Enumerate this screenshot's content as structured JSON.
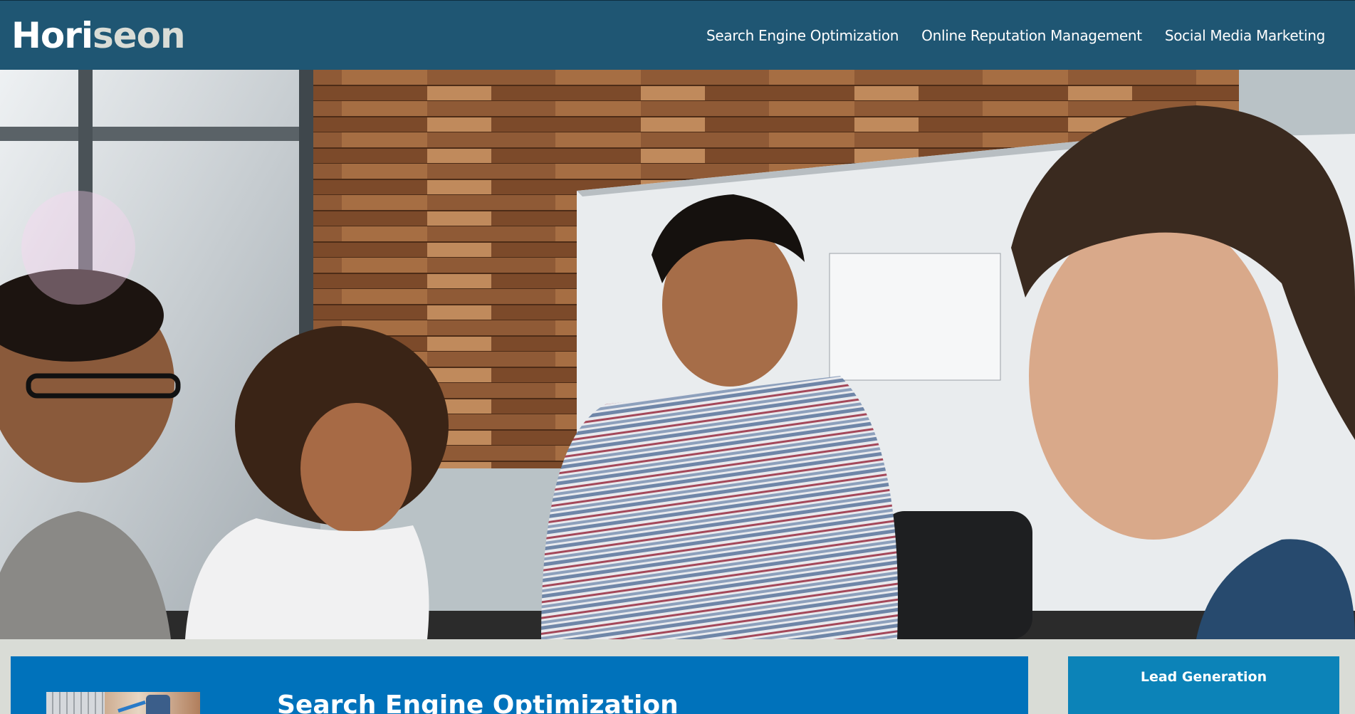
{
  "header": {
    "logo_main": "Hori",
    "logo_accent": "seon",
    "nav": [
      {
        "label": "Search Engine Optimization"
      },
      {
        "label": "Online Reputation Management"
      },
      {
        "label": "Social Media Marketing"
      }
    ]
  },
  "hero": {
    "image": "team-meeting-photo"
  },
  "content": {
    "title": "Search Engine Optimization"
  },
  "aside": {
    "title": "Lead Generation"
  },
  "colors": {
    "header": "#1f5673",
    "page_bg": "#d9dcd6",
    "content_bg": "#0072bb",
    "aside_bg": "#0c83b8"
  }
}
